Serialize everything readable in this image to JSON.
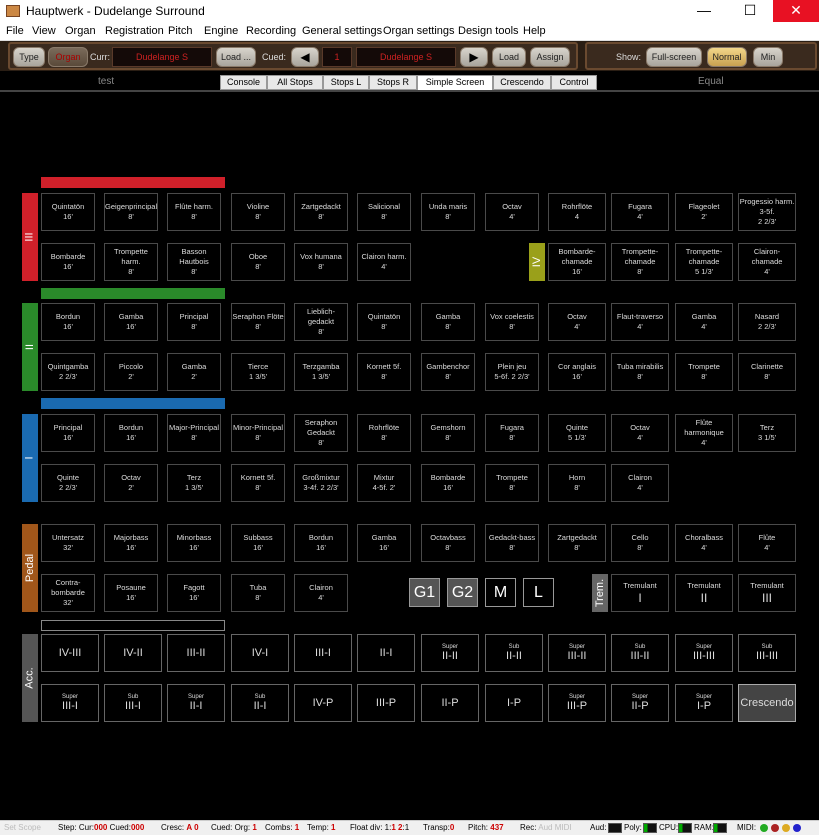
{
  "window": {
    "title": "Hauptwerk - Dudelange Surround",
    "minimize": "—",
    "maximize": "☐",
    "close": "✕"
  },
  "menu": [
    "File",
    "View",
    "Organ",
    "Registration",
    "Pitch",
    "Engine",
    "Recording",
    "General settings",
    "Organ settings",
    "Design tools",
    "Help"
  ],
  "toolbar": {
    "type_label": "Type",
    "organ_label": "Organ",
    "curr_label": "Curr:",
    "curr_value": "Dudelange S",
    "load_dots": "Load ...",
    "cued_label": "Cued:",
    "prev_arrow": "◀",
    "cued_number": "1",
    "cued_value": "Dudelange S",
    "next_arrow": "▶",
    "load": "Load",
    "assign": "Assign",
    "show_label": "Show:",
    "fullscreen": "Full-screen",
    "normal": "Normal",
    "min": "Min"
  },
  "tabs": {
    "left_label": "test",
    "right_label": "Equal",
    "items": [
      "Console",
      "All Stops",
      "Stops L",
      "Stops R",
      "Simple Screen",
      "Crescendo",
      "Control"
    ],
    "active": "Simple Screen"
  },
  "divisions": {
    "III": {
      "label": "III",
      "color": "#d0202a"
    },
    "IV": {
      "label": "IV",
      "color": "#9aa01a"
    },
    "II": {
      "label": "II",
      "color": "#2a8a2a"
    },
    "I": {
      "label": "I",
      "color": "#1a6ab0"
    },
    "Pedal": {
      "label": "Pedal",
      "color": "#a0561a"
    },
    "Trem": {
      "label": "Trem.",
      "color": "#666666"
    },
    "Acc": {
      "label": "Acc.",
      "color": "#555555"
    }
  },
  "stops": [
    {
      "name": "Quintatön",
      "pitch": "16'"
    },
    {
      "name": "Geigenprincipal",
      "pitch": "8'"
    },
    {
      "name": "Flûte harm.",
      "pitch": "8'"
    },
    {
      "name": "Violine",
      "pitch": "8'"
    },
    {
      "name": "Zartgedackt",
      "pitch": "8'"
    },
    {
      "name": "Salicional",
      "pitch": "8'"
    },
    {
      "name": "Unda maris",
      "pitch": "8'"
    },
    {
      "name": "Octav",
      "pitch": "4'"
    },
    {
      "name": "Rohrflöte",
      "pitch": "4"
    },
    {
      "name": "Fugara",
      "pitch": "4'"
    },
    {
      "name": "Flageolet",
      "pitch": "2'"
    },
    {
      "name": "Progessio harm. 3-5f.",
      "pitch": "2 2/3'"
    },
    {
      "name": "Bombarde",
      "pitch": "16'"
    },
    {
      "name": "Trompette harm.",
      "pitch": "8'"
    },
    {
      "name": "Basson Hautbois",
      "pitch": "8'"
    },
    {
      "name": "Oboe",
      "pitch": "8'"
    },
    {
      "name": "Vox humana",
      "pitch": "8'"
    },
    {
      "name": "Clairon harm.",
      "pitch": "4'"
    },
    {
      "name": "Bombarde-chamade",
      "pitch": "16'"
    },
    {
      "name": "Trompette-chamade",
      "pitch": "8'"
    },
    {
      "name": "Trompette-chamade",
      "pitch": "5 1/3'"
    },
    {
      "name": "Clairon-chamade",
      "pitch": "4'"
    },
    {
      "name": "Bordun",
      "pitch": "16'"
    },
    {
      "name": "Gamba",
      "pitch": "16'"
    },
    {
      "name": "Principal",
      "pitch": "8'"
    },
    {
      "name": "Seraphon Flöte",
      "pitch": "8'"
    },
    {
      "name": "Lieblich-gedackt",
      "pitch": "8'"
    },
    {
      "name": "Quintatön",
      "pitch": "8'"
    },
    {
      "name": "Gamba",
      "pitch": "8'"
    },
    {
      "name": "Vox coelestis",
      "pitch": "8'"
    },
    {
      "name": "Octav",
      "pitch": "4'"
    },
    {
      "name": "Flaut-traverso",
      "pitch": "4'"
    },
    {
      "name": "Gamba",
      "pitch": "4'"
    },
    {
      "name": "Nasard",
      "pitch": "2 2/3'"
    },
    {
      "name": "Quintgamba",
      "pitch": "2 2/3'"
    },
    {
      "name": "Piccolo",
      "pitch": "2'"
    },
    {
      "name": "Gamba",
      "pitch": "2'"
    },
    {
      "name": "Tierce",
      "pitch": "1 3/5'"
    },
    {
      "name": "Terzgamba",
      "pitch": "1 3/5'"
    },
    {
      "name": "Kornett 5f.",
      "pitch": "8'"
    },
    {
      "name": "Gambenchor",
      "pitch": "8'"
    },
    {
      "name": "Plein jeu",
      "pitch": "5-6f. 2 2/3'"
    },
    {
      "name": "Cor anglais",
      "pitch": "16'"
    },
    {
      "name": "Tuba mirabilis",
      "pitch": "8'"
    },
    {
      "name": "Trompete",
      "pitch": "8'"
    },
    {
      "name": "Clarinette",
      "pitch": "8'"
    },
    {
      "name": "Principal",
      "pitch": "16'"
    },
    {
      "name": "Bordun",
      "pitch": "16'"
    },
    {
      "name": "Major-Principal",
      "pitch": "8'"
    },
    {
      "name": "Minor-Principal",
      "pitch": "8'"
    },
    {
      "name": "Seraphon Gedackt",
      "pitch": "8'"
    },
    {
      "name": "Rohrflöte",
      "pitch": "8'"
    },
    {
      "name": "Gemshorn",
      "pitch": "8'"
    },
    {
      "name": "Fugara",
      "pitch": "8'"
    },
    {
      "name": "Quinte",
      "pitch": "5 1/3'"
    },
    {
      "name": "Octav",
      "pitch": "4'"
    },
    {
      "name": "Flûte harmonique",
      "pitch": "4'"
    },
    {
      "name": "Terz",
      "pitch": "3 1/5'"
    },
    {
      "name": "Quinte",
      "pitch": "2 2/3'"
    },
    {
      "name": "Octav",
      "pitch": "2'"
    },
    {
      "name": "Terz",
      "pitch": "1 3/5'"
    },
    {
      "name": "Kornett 5f.",
      "pitch": "8'"
    },
    {
      "name": "Großmixtur",
      "pitch": "3-4f. 2 2/3'"
    },
    {
      "name": "Mixtur",
      "pitch": "4-5f. 2'"
    },
    {
      "name": "Bombarde",
      "pitch": "16'"
    },
    {
      "name": "Trompete",
      "pitch": "8'"
    },
    {
      "name": "Horn",
      "pitch": "8'"
    },
    {
      "name": "Clairon",
      "pitch": "4'"
    },
    {
      "name": "Untersatz",
      "pitch": "32'"
    },
    {
      "name": "Majorbass",
      "pitch": "16'"
    },
    {
      "name": "Minorbass",
      "pitch": "16'"
    },
    {
      "name": "Subbass",
      "pitch": "16'"
    },
    {
      "name": "Bordun",
      "pitch": "16'"
    },
    {
      "name": "Gamba",
      "pitch": "16'"
    },
    {
      "name": "Octavbass",
      "pitch": "8'"
    },
    {
      "name": "Gedackt-bass",
      "pitch": "8'"
    },
    {
      "name": "Zartgedackt",
      "pitch": "8'"
    },
    {
      "name": "Cello",
      "pitch": "8'"
    },
    {
      "name": "Choralbass",
      "pitch": "4'"
    },
    {
      "name": "Flûte",
      "pitch": "4'"
    },
    {
      "name": "Contra-bombarde",
      "pitch": "32'"
    },
    {
      "name": "Posaune",
      "pitch": "16'"
    },
    {
      "name": "Fagott",
      "pitch": "16'"
    },
    {
      "name": "Tuba",
      "pitch": "8'"
    },
    {
      "name": "Clairon",
      "pitch": "4'"
    },
    {
      "name": "Tremulant",
      "pitch": "I"
    },
    {
      "name": "Tremulant",
      "pitch": "II"
    },
    {
      "name": "Tremulant",
      "pitch": "III"
    }
  ],
  "generals": [
    "G1",
    "G2",
    "M",
    "L"
  ],
  "couplers": [
    {
      "small": "",
      "main": "IV-III"
    },
    {
      "small": "",
      "main": "IV-II"
    },
    {
      "small": "",
      "main": "III-II"
    },
    {
      "small": "",
      "main": "IV-I"
    },
    {
      "small": "",
      "main": "III-I"
    },
    {
      "small": "",
      "main": "II-I"
    },
    {
      "small": "Super",
      "main": "II-II"
    },
    {
      "small": "Sub",
      "main": "II-II"
    },
    {
      "small": "Super",
      "main": "III-II"
    },
    {
      "small": "Sub",
      "main": "III-II"
    },
    {
      "small": "Super",
      "main": "III-III"
    },
    {
      "small": "Sub",
      "main": "III-III"
    },
    {
      "small": "Super",
      "main": "III-I"
    },
    {
      "small": "Sub",
      "main": "III-I"
    },
    {
      "small": "Super",
      "main": "II-I"
    },
    {
      "small": "Sub",
      "main": "II-I"
    },
    {
      "small": "",
      "main": "IV-P"
    },
    {
      "small": "",
      "main": "III-P"
    },
    {
      "small": "",
      "main": "II-P"
    },
    {
      "small": "",
      "main": "I-P"
    },
    {
      "small": "Super",
      "main": "III-P"
    },
    {
      "small": "Super",
      "main": "II-P"
    },
    {
      "small": "Super",
      "main": "I-P"
    },
    {
      "small": "",
      "main": "Crescendo"
    }
  ],
  "status": {
    "set_scope": "Set Scope",
    "step_label": "Step: Cur:",
    "step_cur": "000",
    "cued_label": "Cued:",
    "cued_val": "000",
    "cresc_label": "Cresc:",
    "cresc_val": "A 0",
    "cued_org_label": "Cued: Org:",
    "cued_org_val": "1",
    "combs_label": "Combs:",
    "combs_val": "1",
    "temp_label": "Temp:",
    "temp_val": "1",
    "float_label": "Float div: 1:",
    "float_val": "1 2",
    "float_tail": ":1",
    "transp_label": "Transp:",
    "transp_val": "0",
    "pitch_label": "Pitch:",
    "pitch_val": "437",
    "rec_label": "Rec:",
    "rec_val": "Aud MIDI",
    "aud_label": "Aud:",
    "poly_label": "Poly:",
    "cpu_label": "CPU:",
    "ram_label": "RAM:",
    "midi_label": "MIDI:"
  }
}
